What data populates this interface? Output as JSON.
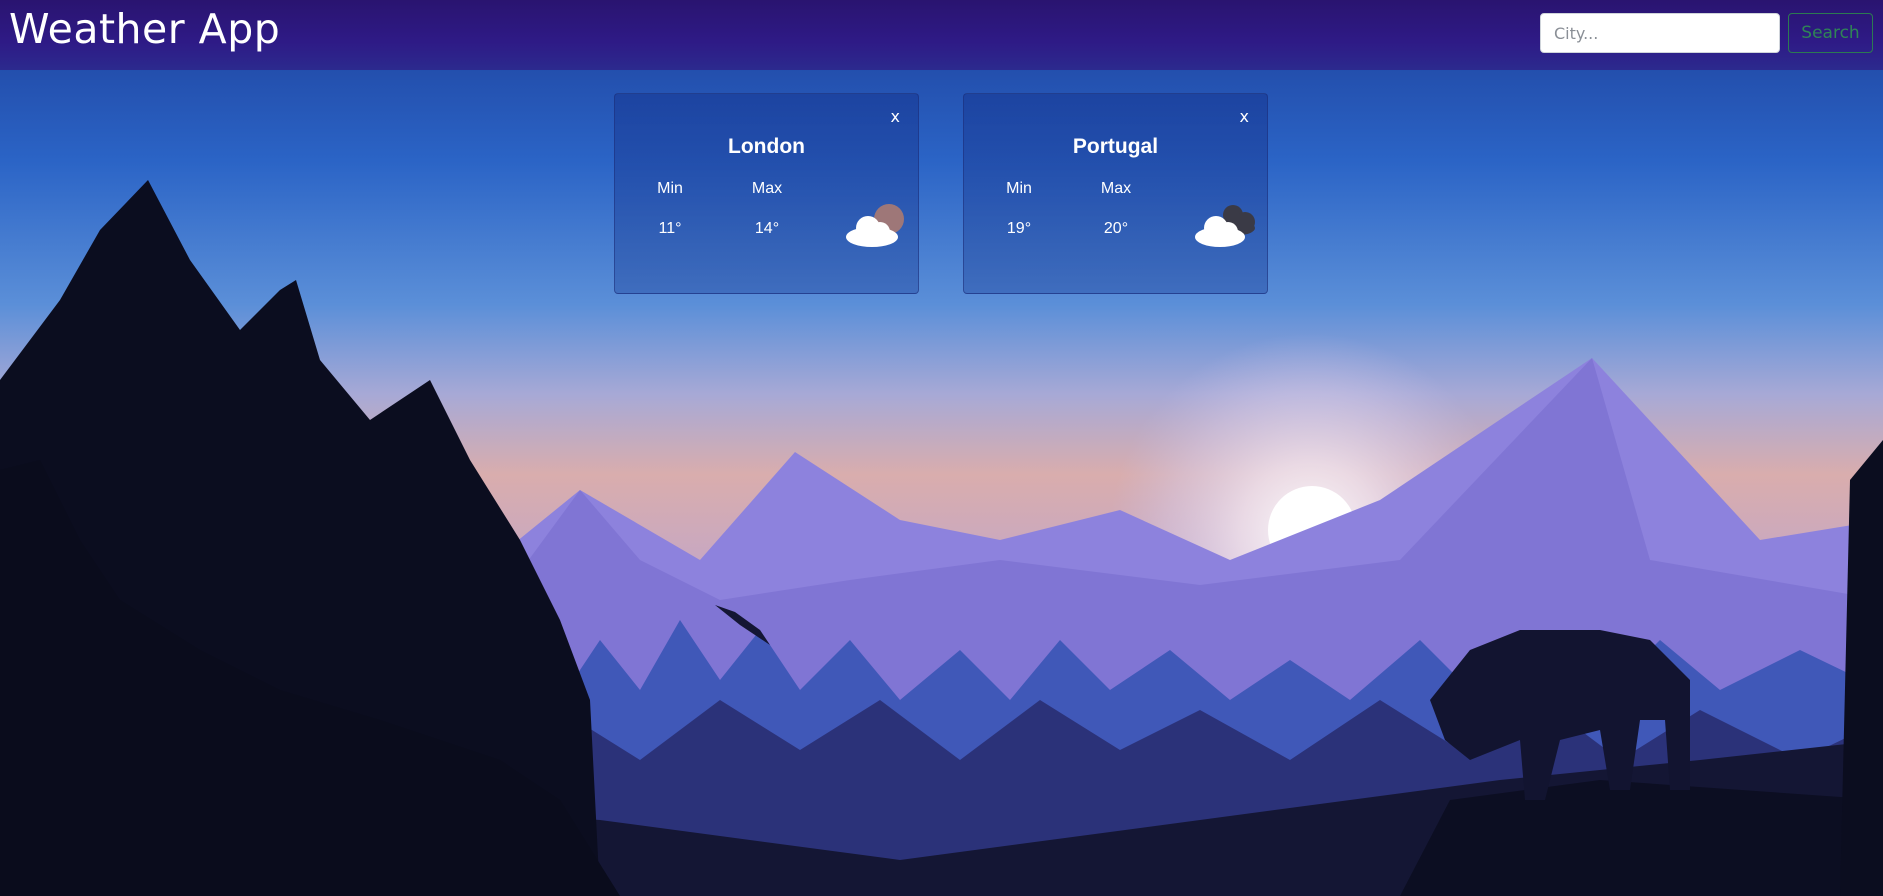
{
  "header": {
    "title": "Weather App",
    "search_placeholder": "City...",
    "search_button": "Search"
  },
  "cards": [
    {
      "city": "London",
      "close": "x",
      "min_label": "Min",
      "max_label": "Max",
      "min": "11°",
      "max": "14°",
      "icon": "partly-cloudy-icon"
    },
    {
      "city": "Portugal",
      "close": "x",
      "min_label": "Min",
      "max_label": "Max",
      "min": "19°",
      "max": "20°",
      "icon": "dark-clouds-icon"
    }
  ],
  "colors": {
    "header": "#2e1a86",
    "search_button_border": "#2c7a52",
    "card_background": "#2a52a5"
  }
}
